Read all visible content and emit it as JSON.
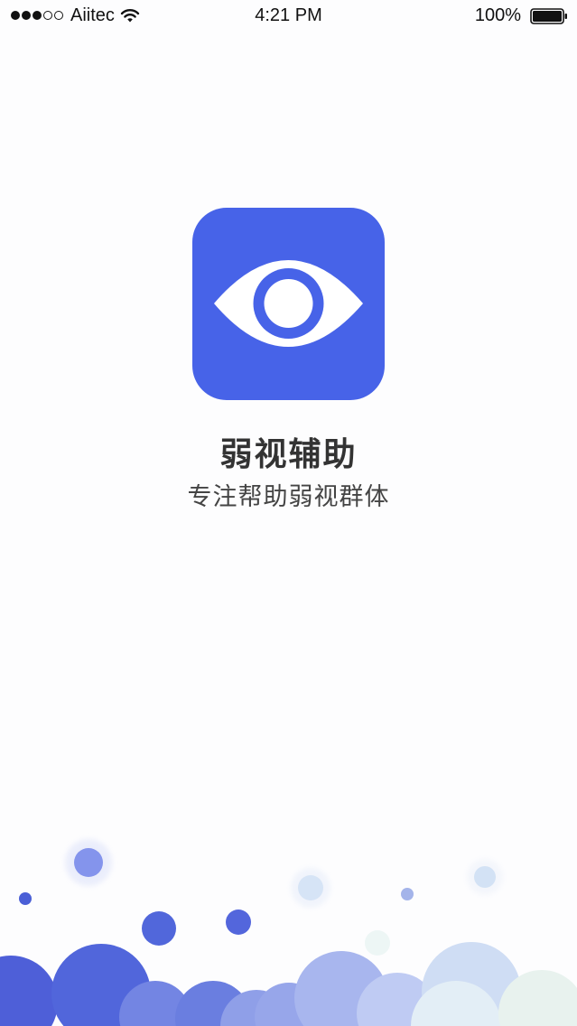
{
  "status_bar": {
    "carrier": "Aiitec",
    "time": "4:21 PM",
    "battery_percent": "100%",
    "signal_bars": 3,
    "signal_total": 5,
    "battery_level": 1.0
  },
  "splash": {
    "app_name": "弱视辅助",
    "slogan": "专注帮助弱视群体",
    "icon": "eye-icon"
  },
  "colors": {
    "brand": "#4763e8",
    "text_primary": "#333333",
    "background": "#fdfdfe"
  }
}
